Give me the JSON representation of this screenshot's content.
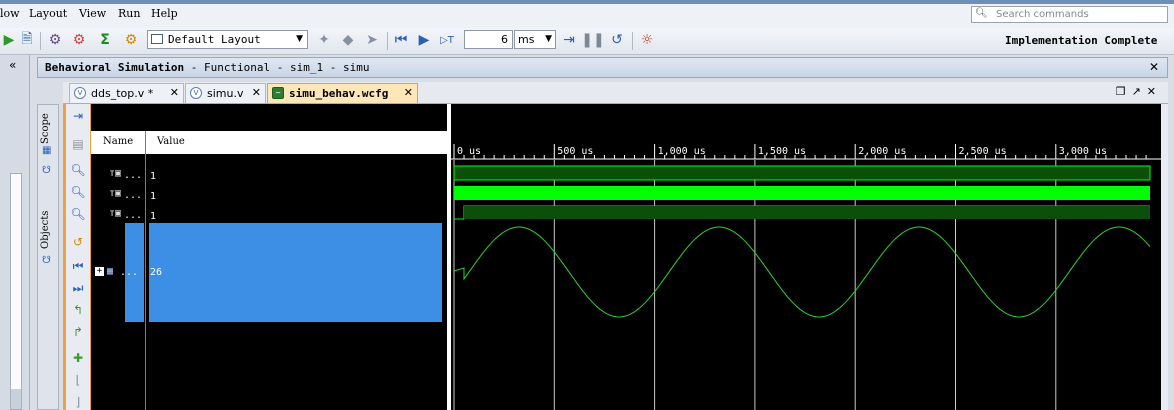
{
  "menu": {
    "items": [
      "low",
      "Layout",
      "View",
      "Run",
      "Help"
    ]
  },
  "search": {
    "placeholder": "Search commands"
  },
  "toolbar": {
    "layout_select": "Default Layout",
    "run_time_value": "6",
    "run_time_unit": "ms",
    "status": "Implementation Complete"
  },
  "panel": {
    "title_bold": "Behavioral Simulation",
    "title_rest": " - Functional - sim_1 - simu"
  },
  "tabs": [
    {
      "label": "dds_top.v *",
      "active": false
    },
    {
      "label": "simu.v",
      "active": false
    },
    {
      "label": "simu_behav.wcfg",
      "active": true
    }
  ],
  "side_tabs": {
    "scope": "Scope",
    "objects": "Objects"
  },
  "wave": {
    "headers": {
      "name": "Name",
      "value": "Value"
    },
    "signals": [
      {
        "name": "...",
        "value": "1"
      },
      {
        "name": "...",
        "value": "1"
      },
      {
        "name": "...",
        "value": "1"
      }
    ],
    "bus": {
      "name": "...",
      "value": "26"
    },
    "time_ticks": [
      "0 us",
      "500 us",
      "1,000 us",
      "1,500 us",
      "2,000 us",
      "2,500 us",
      "3,000 us"
    ],
    "colors": {
      "waveform": "#00ff00",
      "dark_band": "#0b4f0b",
      "highlight": "#3d8fe6"
    }
  },
  "icons": {
    "toolbar": [
      "run-icon",
      "add-source-icon",
      "settings-icon",
      "sigma-icon",
      "gear-icon",
      "layout-icon",
      "pin-icon",
      "flag-icon",
      "cursor-icon",
      "restart-icon",
      "run-all-icon",
      "run-for-time-icon",
      "step-icon",
      "pause-icon",
      "relaunch-icon",
      "help-icon"
    ]
  }
}
